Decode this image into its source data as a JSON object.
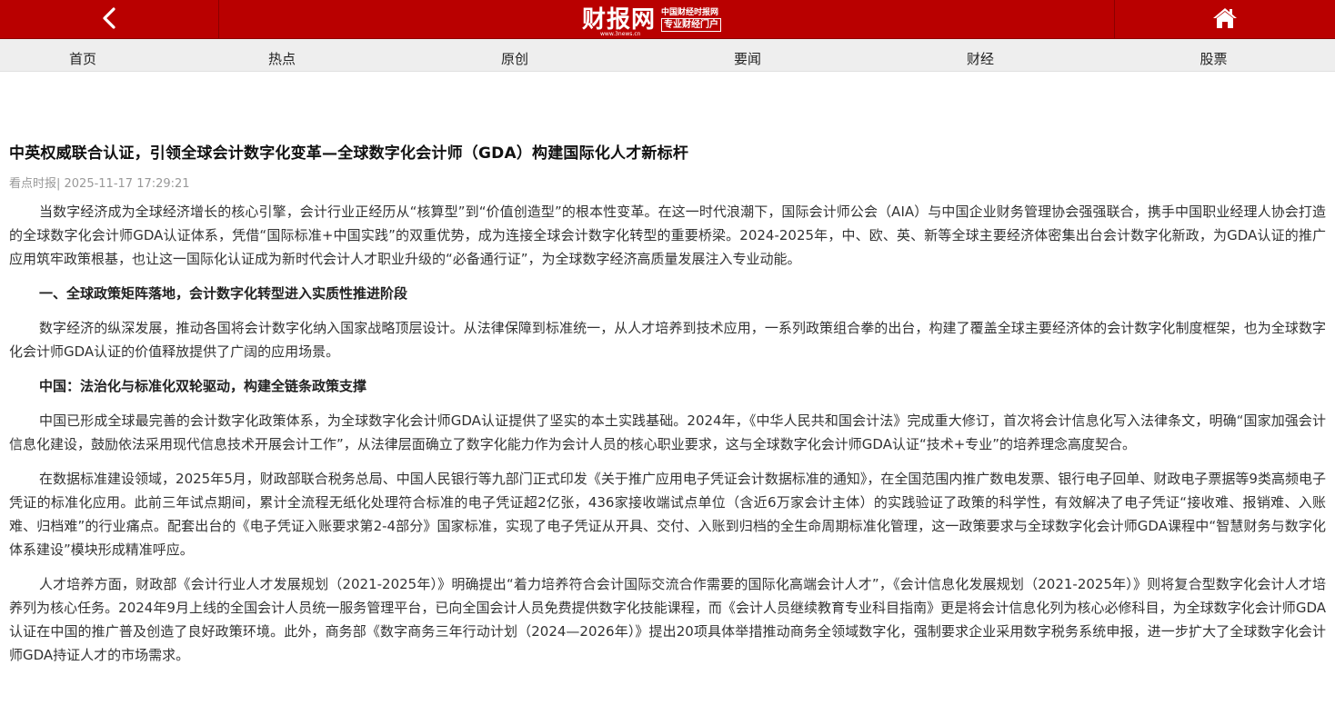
{
  "header": {
    "logo_main": "财报网",
    "logo_sub1": "中国财经时报网",
    "logo_sub2": "专业财经门户",
    "logo_url": "www.3news.cn",
    "colors": {
      "brand_red": "#b90000",
      "nav_bg": "#eeeeee"
    },
    "back_icon": "chevron-left-icon",
    "home_icon": "home-icon"
  },
  "nav": {
    "items": [
      {
        "label": "首页"
      },
      {
        "label": "热点"
      },
      {
        "label": "原创"
      },
      {
        "label": "要闻"
      },
      {
        "label": "财经"
      },
      {
        "label": "股票"
      }
    ]
  },
  "article": {
    "title": "中英权威联合认证，引领全球会计数字化变革—全球数字化会计师（GDA）构建国际化人才新标杆",
    "meta": "看点时报| 2025-11-17 17:29:21",
    "p1": "当数字经济成为全球经济增长的核心引擎，会计行业正经历从“核算型”到“价值创造型”的根本性变革。在这一时代浪潮下，国际会计师公会（AIA）与中国企业财务管理协会强强联合，携手中国职业经理人协会打造的全球数字化会计师GDA认证体系，凭借“国际标准+中国实践”的双重优势，成为连接全球会计数字化转型的重要桥梁。2024-2025年，中、欧、英、新等全球主要经济体密集出台会计数字化新政，为GDA认证的推广应用筑牢政策根基，也让这一国际化认证成为新时代会计人才职业升级的“必备通行证”，为全球数字经济高质量发展注入专业动能。",
    "h1": "一、全球政策矩阵落地，会计数字化转型进入实质性推进阶段",
    "p2": "数字经济的纵深发展，推动各国将会计数字化纳入国家战略顶层设计。从法律保障到标准统一，从人才培养到技术应用，一系列政策组合拳的出台，构建了覆盖全球主要经济体的会计数字化制度框架，也为全球数字化会计师GDA认证的价值释放提供了广阔的应用场景。",
    "h2": "中国：法治化与标准化双轮驱动，构建全链条政策支撑",
    "p3": "中国已形成全球最完善的会计数字化政策体系，为全球数字化会计师GDA认证提供了坚实的本土实践基础。2024年，《中华人民共和国会计法》完成重大修订，首次将会计信息化写入法律条文，明确“国家加强会计信息化建设，鼓励依法采用现代信息技术开展会计工作”，从法律层面确立了数字化能力作为会计人员的核心职业要求，这与全球数字化会计师GDA认证“技术+专业”的培养理念高度契合。",
    "p4": "在数据标准建设领域，2025年5月，财政部联合税务总局、中国人民银行等九部门正式印发《关于推广应用电子凭证会计数据标准的通知》，在全国范围内推广数电发票、银行电子回单、财政电子票据等9类高频电子凭证的标准化应用。此前三年试点期间，累计全流程无纸化处理符合标准的电子凭证超2亿张，436家接收端试点单位（含近6万家会计主体）的实践验证了政策的科学性，有效解决了电子凭证“接收难、报销难、入账难、归档难”的行业痛点。配套出台的《电子凭证入账要求第2-4部分》国家标准，实现了电子凭证从开具、交付、入账到归档的全生命周期标准化管理，这一政策要求与全球数字化会计师GDA课程中“智慧财务与数字化体系建设”模块形成精准呼应。",
    "p5": "人才培养方面，财政部《会计行业人才发展规划（2021-2025年）》明确提出“着力培养符合会计国际交流合作需要的国际化高端会计人才”，《会计信息化发展规划（2021-2025年）》则将复合型数字化会计人才培养列为核心任务。2024年9月上线的全国会计人员统一服务管理平台，已向全国会计人员免费提供数字化技能课程，而《会计人员继续教育专业科目指南》更是将会计信息化列为核心必修科目，为全球数字化会计师GDA认证在中国的推广普及创造了良好政策环境。此外，商务部《数字商务三年行动计划（2024—2026年）》提出20项具体举措推动商务全领域数字化，强制要求企业采用数字税务系统申报，进一步扩大了全球数字化会计师GDA持证人才的市场需求。"
  }
}
